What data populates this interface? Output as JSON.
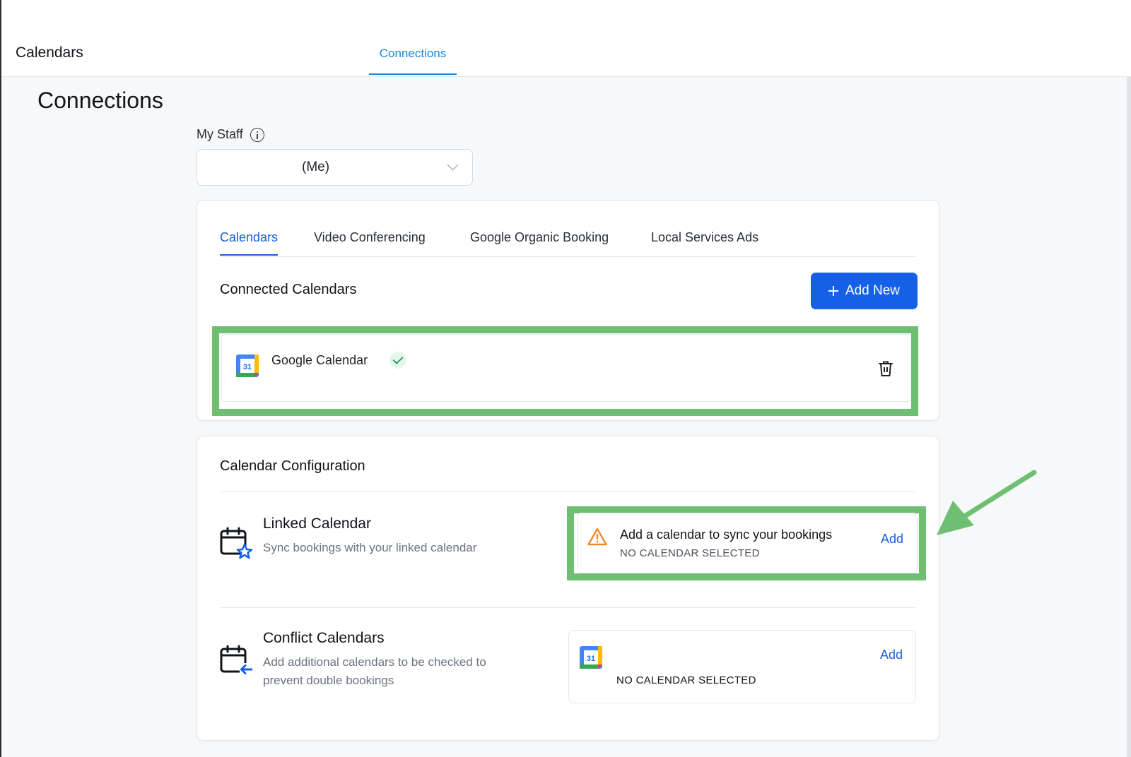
{
  "header": {
    "title": "Calendars",
    "tab": "Connections"
  },
  "page": {
    "title": "Connections"
  },
  "staff": {
    "label": "My Staff",
    "selected": "(Me)"
  },
  "tabs": [
    "Calendars",
    "Video Conferencing",
    "Google Organic Booking",
    "Local Services Ads"
  ],
  "connected": {
    "title": "Connected Calendars",
    "add_new_label": "Add New",
    "calendar_name": "Google Calendar",
    "calendar_icon_text": "31"
  },
  "config": {
    "title": "Calendar Configuration",
    "linked": {
      "title": "Linked Calendar",
      "desc": "Sync bookings with your linked calendar",
      "message": "Add a calendar to sync your bookings",
      "status": "NO CALENDAR SELECTED",
      "add_label": "Add"
    },
    "conflict": {
      "title": "Conflict Calendars",
      "desc": "Add additional calendars to be checked to prevent double bookings",
      "status": "NO CALENDAR SELECTED",
      "add_label": "Add"
    }
  },
  "colors": {
    "accent": "#1660e8",
    "highlight": "#6fbf73",
    "warning": "#f08a24",
    "success": "#2da05a"
  }
}
